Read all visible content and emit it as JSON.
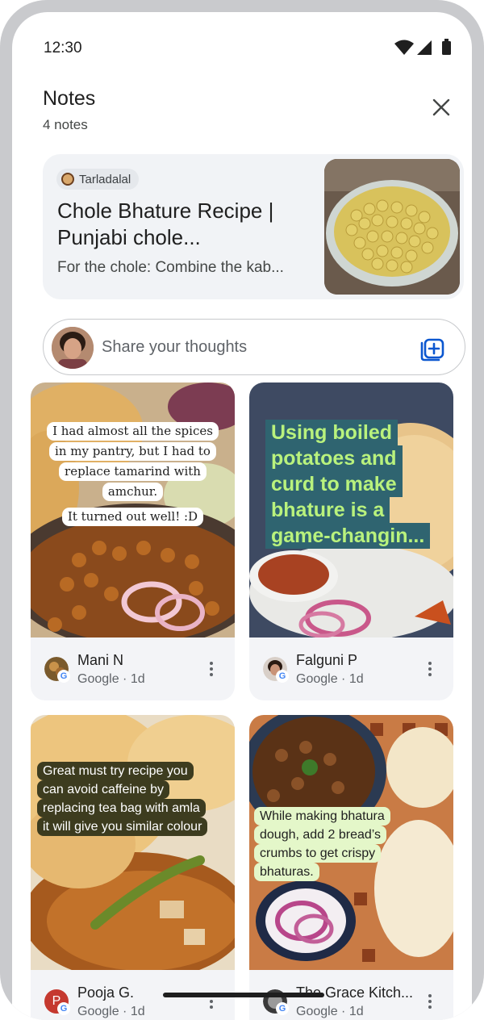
{
  "status_bar": {
    "time": "12:30"
  },
  "header": {
    "title": "Notes",
    "subtitle": "4 notes"
  },
  "source_card": {
    "source_name": "Tarladalal",
    "title": "Chole Bhature Recipe | Punjabi chole...",
    "snippet": "For the chole: Combine the kab..."
  },
  "share": {
    "placeholder": "Share your thoughts"
  },
  "notes": [
    {
      "overlay_lines": [
        "I had almost all the spices",
        "in my pantry, but I had to",
        "replace tamarind with",
        "amchur."
      ],
      "overlay_extra": "It turned out well! :D",
      "author": "Mani N",
      "meta": "Google · 1d"
    },
    {
      "overlay_lines": [
        "Using boiled",
        "potatoes and",
        "curd to make",
        "bhature is a",
        "game-changin..."
      ],
      "author": "Falguni P",
      "meta": "Google · 1d"
    },
    {
      "overlay_lines": [
        "Great must try recipe you",
        "can avoid caffeine by",
        "replacing tea bag with amla",
        "it will give you similar colour"
      ],
      "author": "Pooja G.",
      "avatar_letter": "P",
      "meta": "Google · 1d"
    },
    {
      "overlay_lines": [
        "While making bhatura",
        "dough, add 2 bread’s",
        "crumbs to get crispy",
        "bhaturas."
      ],
      "author": "The Grace Kitch...",
      "meta": "Google · 1d"
    }
  ],
  "colors": {
    "accent_blue": "#0b57d0",
    "card_bg": "#f3f4f7",
    "overlay_green_text": "#b9f27d"
  }
}
